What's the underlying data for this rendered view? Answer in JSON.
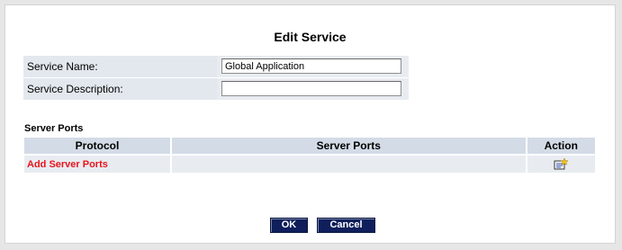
{
  "title": "Edit Service",
  "form": {
    "service_name_label": "Service Name:",
    "service_name_value": "Global Application",
    "service_description_label": "Service Description:",
    "service_description_value": ""
  },
  "server_ports": {
    "heading": "Server Ports",
    "columns": [
      "Protocol",
      "Server Ports",
      "Action"
    ],
    "add_link_label": "Add Server Ports",
    "add_icon": "edit-add-icon"
  },
  "buttons": {
    "ok_label": "OK",
    "cancel_label": "Cancel"
  },
  "colors": {
    "accent_red": "#e8141b",
    "button_navy": "#0f1f5c",
    "row_background": "#e8ecf1",
    "header_background": "#d3dbe6"
  }
}
